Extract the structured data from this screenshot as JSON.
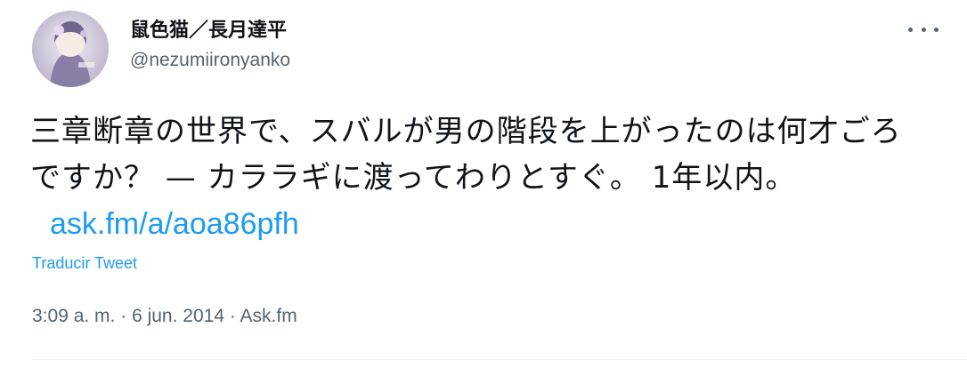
{
  "user": {
    "display_name": "鼠色猫／長月達平",
    "handle": "@nezumiironyanko"
  },
  "tweet": {
    "text": "三章断章の世界で、スバルが男の階段を上がったのは何才ごろですか？ — カララギに渡ってわりとすぐ。 1年以内。",
    "link": "ask.fm/a/aoa86pfh",
    "translate_label": "Traducir Tweet",
    "time": "3:09 a. m.",
    "date": "6 jun. 2014",
    "source": "Ask.fm",
    "separator": "·"
  },
  "icons": {
    "more": "more-horizontal-icon",
    "avatar": "user-avatar"
  },
  "colors": {
    "link": "#1d9bf0",
    "secondary_text": "#536471",
    "primary_text": "#0f1419"
  }
}
